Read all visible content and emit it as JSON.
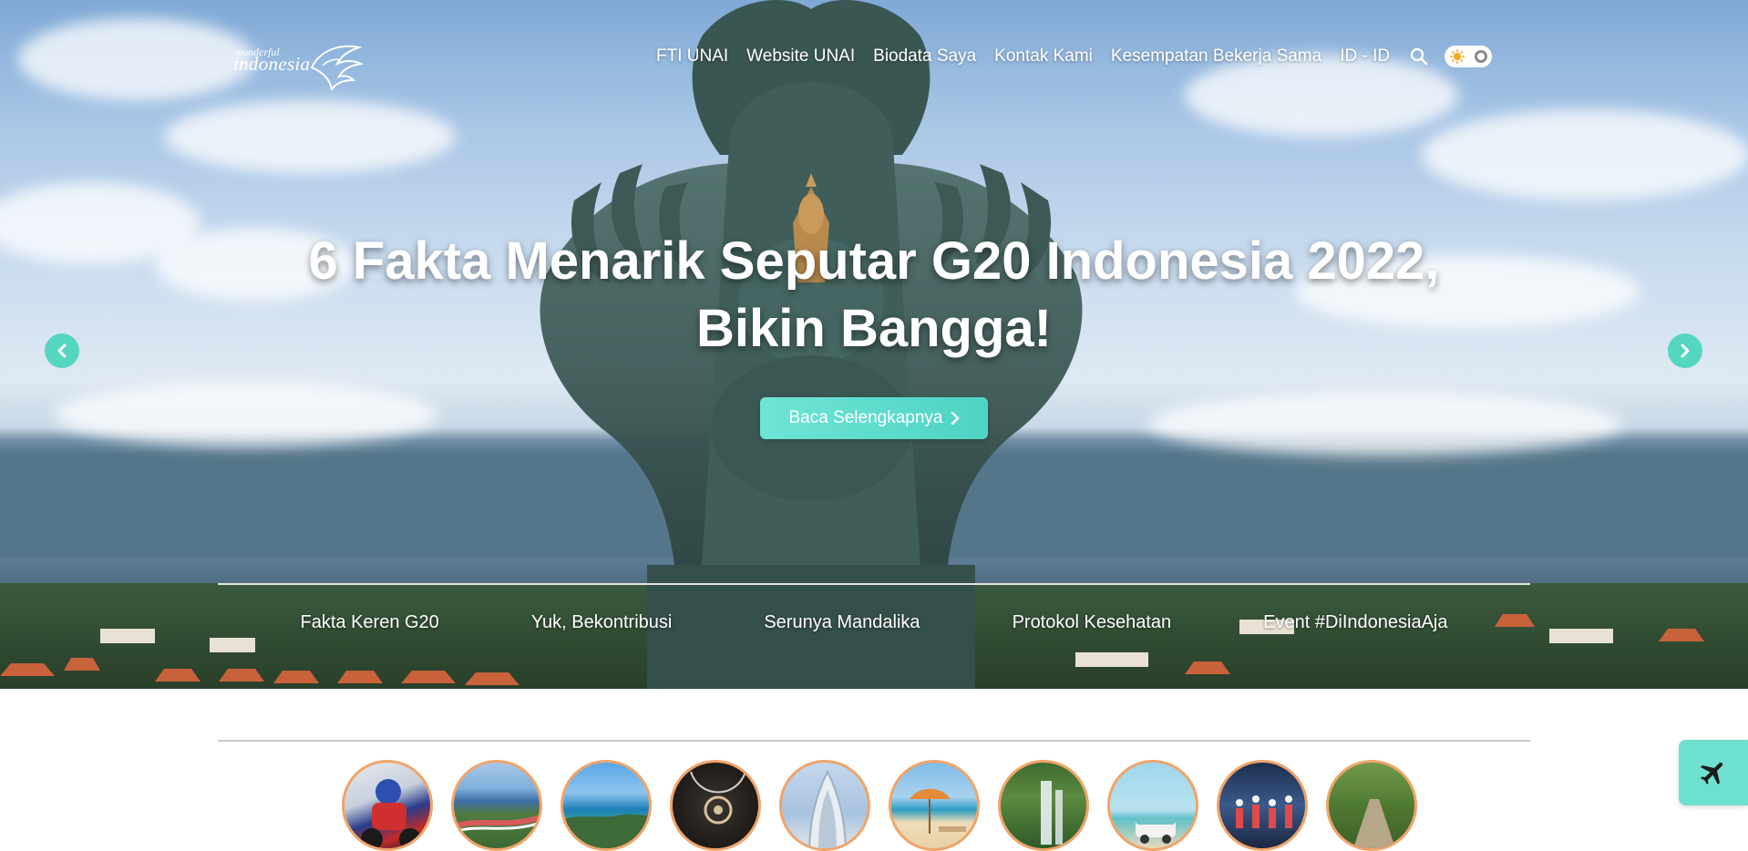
{
  "brand": {
    "logo_small": "wonderful",
    "logo_large": "indonesia"
  },
  "nav": {
    "items": [
      {
        "label": "FTI UNAI"
      },
      {
        "label": "Website UNAI"
      },
      {
        "label": "Biodata Saya"
      },
      {
        "label": "Kontak Kami"
      },
      {
        "label": "Kesempatan Bekerja Sama"
      },
      {
        "label": "ID - ID"
      }
    ],
    "search_icon": "search-icon",
    "theme_toggle_icon": "sun-icon"
  },
  "hero": {
    "headline": "6 Fakta Menarik Seputar G20 Indonesia 2022, Bikin Bangga!",
    "cta_label": "Baca Selengkapnya",
    "prev_icon": "chevron-left-icon",
    "next_icon": "chevron-right-icon",
    "tabs": [
      {
        "label": "Fakta Keren G20"
      },
      {
        "label": "Yuk, Bekontribusi"
      },
      {
        "label": "Serunya Mandalika"
      },
      {
        "label": "Protokol Kesehatan"
      },
      {
        "label": "Event #DiIndonesiaAja"
      }
    ]
  },
  "destinations": [
    {
      "icon": "motorbike-racer-photo"
    },
    {
      "icon": "racing-circuit-photo"
    },
    {
      "icon": "beach-coast-photo"
    },
    {
      "icon": "pendant-necklace-photo"
    },
    {
      "icon": "church-building-photo"
    },
    {
      "icon": "beach-umbrella-photo"
    },
    {
      "icon": "waterfall-photo"
    },
    {
      "icon": "camper-van-beach-photo"
    },
    {
      "icon": "dancers-performance-photo"
    },
    {
      "icon": "forest-path-photo"
    }
  ],
  "floating_action": {
    "icon": "airplane-icon"
  },
  "colors": {
    "accent": "#55d6c0",
    "circle_border": "#f0a46a",
    "cta": "#5fdccb"
  }
}
